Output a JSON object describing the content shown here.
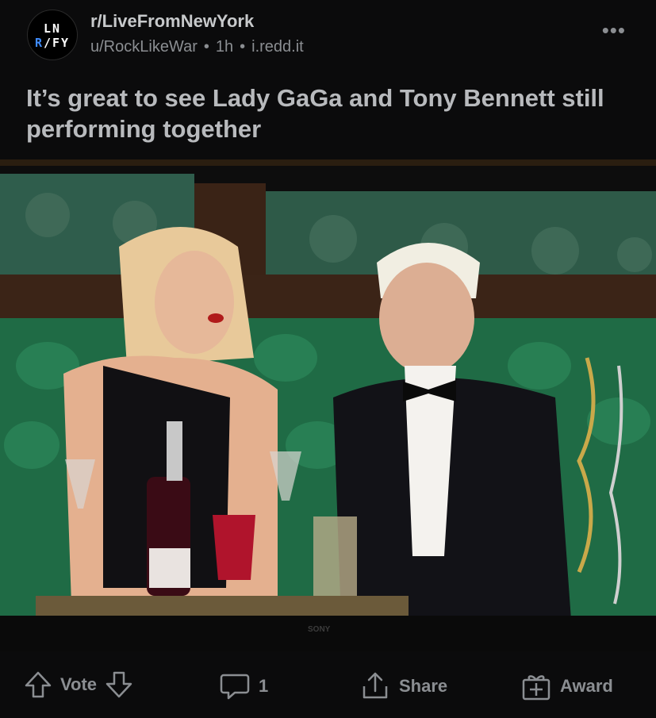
{
  "post": {
    "subreddit": "r/LiveFromNewYork",
    "author": "u/RockLikeWar",
    "age": "1h",
    "domain": "i.redd.it",
    "more_label": "•••",
    "title": "It’s great to see Lady GaGa and Tony Bennett still performing together"
  },
  "avatar": {
    "line1": "LN",
    "line2_a": "R",
    "line2_b": "FY"
  },
  "image": {
    "brand": "SONY"
  },
  "actions": {
    "vote_label": "Vote",
    "comments_count": "1",
    "share_label": "Share",
    "award_label": "Award"
  },
  "colors": {
    "background": "#0b0b0c",
    "muted": "#8b8e92",
    "title": "#b8babd"
  }
}
